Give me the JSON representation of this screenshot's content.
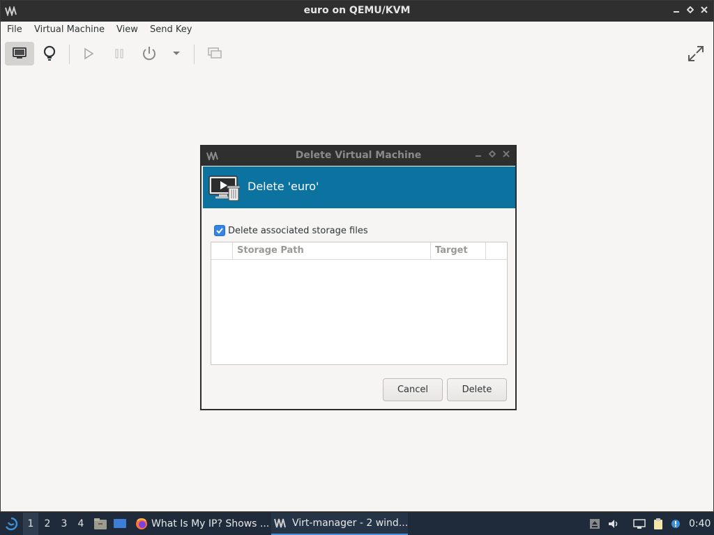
{
  "window": {
    "title": "euro on QEMU/KVM"
  },
  "menubar": {
    "items": [
      "File",
      "Virtual Machine",
      "View",
      "Send Key"
    ]
  },
  "dialog": {
    "title": "Delete Virtual Machine",
    "banner_title": "Delete 'euro'",
    "checkbox": {
      "label": "Delete associated storage files",
      "checked": true
    },
    "table": {
      "columns": [
        "",
        "Storage Path",
        "Target",
        ""
      ],
      "rows": []
    },
    "buttons": {
      "cancel": "Cancel",
      "delete": "Delete"
    }
  },
  "taskbar": {
    "workspaces": [
      "1",
      "2",
      "3",
      "4"
    ],
    "active_workspace": "1",
    "tasks": [
      {
        "label": "What Is My IP? Shows ...",
        "icon": "firefox-icon"
      },
      {
        "label": "Virt-manager - 2 wind...",
        "icon": "virt-manager-icon"
      }
    ],
    "clock": "0:40"
  },
  "colors": {
    "banner": "#0c73a1",
    "titlebar": "#2f2f2f",
    "taskbar": "#1f2b3a",
    "checkbox": "#3584e4"
  }
}
